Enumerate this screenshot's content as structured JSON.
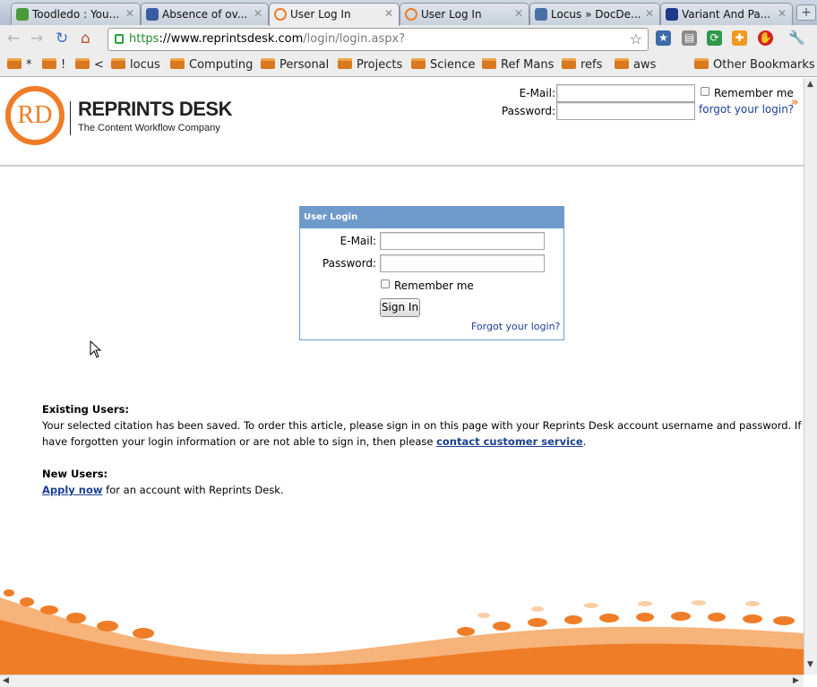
{
  "browser": {
    "tabs": [
      {
        "title": "Toodledo : You...",
        "active": false,
        "color": "#4a9a3a"
      },
      {
        "title": "Absence of ov...",
        "active": false,
        "color": "#3a5da0"
      },
      {
        "title": "User Log In",
        "active": true,
        "color": "#ef7d27"
      },
      {
        "title": "User Log In",
        "active": false,
        "color": "#ef7d27"
      },
      {
        "title": "Locus » DocDe...",
        "active": false,
        "color": "#4a6fa5"
      },
      {
        "title": "Variant And Pa...",
        "active": false,
        "color": "#1d3a8a"
      }
    ],
    "url": {
      "scheme": "https",
      "host": "://www.reprintsdesk.com",
      "path": "/login/login.aspx?"
    },
    "bookmarks": [
      {
        "label": "*"
      },
      {
        "label": "!"
      },
      {
        "label": "<"
      },
      {
        "label": "locus"
      },
      {
        "label": "Computing"
      },
      {
        "label": "Personal"
      },
      {
        "label": "Projects"
      },
      {
        "label": "Science"
      },
      {
        "label": "Ref Mans"
      },
      {
        "label": "refs"
      },
      {
        "label": "aws"
      }
    ],
    "other_bookmarks": "Other Bookmarks"
  },
  "header": {
    "logo_mark": "RD",
    "brand": "REPRINTS DESK",
    "tagline": "The Content Workflow Company",
    "email_label": "E-Mail:",
    "password_label": "Password:",
    "remember_label": "Remember me",
    "forgot_label": "forgot your login?",
    "forgot_chevron": "»"
  },
  "login_box": {
    "title": "User Login",
    "email_label": "E-Mail:",
    "password_label": "Password:",
    "remember_label": "Remember me",
    "sign_in": "Sign In",
    "forgot": "Forgot your login?"
  },
  "info": {
    "existing_heading": "Existing Users:",
    "existing_text_1": "Your selected citation has been saved. To order this article, please sign in on this page with your Reprints Desk account username and password. If y",
    "existing_text_2a": "have forgotten your login information or are not able to sign in, then please ",
    "existing_link": "contact customer service",
    "existing_text_2b": ".",
    "new_heading": "New Users:",
    "new_link": "Apply now",
    "new_text": " for an account with Reprints Desk."
  },
  "colors": {
    "brand_orange": "#ef7d27",
    "box_blue": "#6f9bcb",
    "link_blue": "#1c3f94"
  }
}
